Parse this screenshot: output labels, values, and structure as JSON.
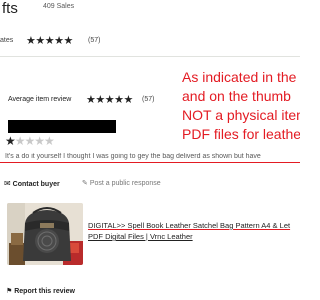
{
  "header": {
    "shop_name": "fts",
    "sales": "409 Sales",
    "rates_word": "ates",
    "stars": "★★★★★",
    "count": "(57)"
  },
  "annotation": {
    "lines": [
      "As indicated in the",
      "and on the thumb",
      "NOT a physical item",
      "PDF files for leather"
    ],
    "color": "#e31b23"
  },
  "summary": {
    "label": "Average item review",
    "stars": "★★★★★",
    "count": "(57)"
  },
  "review": {
    "stars_filled": "★",
    "stars_empty": "★★★★",
    "text": "It's a do it yourself I thought I was going to gey the bag deliverd as shown but have"
  },
  "actions": {
    "contact_icon": "envelope-icon",
    "contact_label": "Contact buyer",
    "post_icon": "pencil-icon",
    "post_label": "Post a public response"
  },
  "listing": {
    "line1": "DIGITAL>> Spell Book Leather Satchel Bag Pattern A4 & Let",
    "line2": "PDF Digital Files | Vrnc Leather"
  },
  "report": {
    "icon": "flag-icon",
    "label": "Report this review"
  }
}
